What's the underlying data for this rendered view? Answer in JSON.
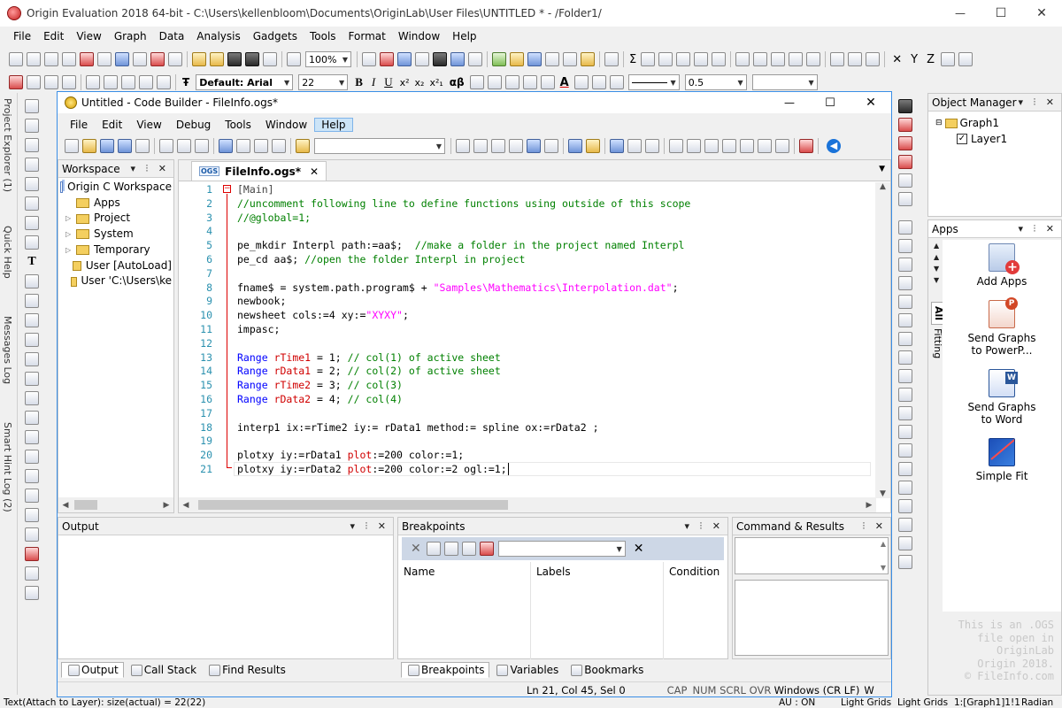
{
  "titlebar": {
    "title": "Origin Evaluation 2018 64-bit - C:\\Users\\kellenbloom\\Documents\\OriginLab\\User Files\\UNTITLED * - /Folder1/",
    "min": "—",
    "max": "☐",
    "close": "✕"
  },
  "main_menu": [
    "File",
    "Edit",
    "View",
    "Graph",
    "Data",
    "Analysis",
    "Gadgets",
    "Tools",
    "Format",
    "Window",
    "Help"
  ],
  "toolbar": {
    "zoom": "100%",
    "font_name": "Default: Arial",
    "font_size": "22",
    "bold": "B",
    "italic": "I",
    "underline": "U",
    "greek": "αβ",
    "line_width": "0.5",
    "xyz": [
      "X",
      "Y",
      "Z"
    ]
  },
  "left_tabs": [
    "Project Explorer (1)",
    "Quick Help",
    "Messages Log",
    "Smart Hint Log (2)"
  ],
  "codebuilder": {
    "title": "Untitled - Code Builder - FileInfo.ogs*",
    "menu": [
      "File",
      "Edit",
      "View",
      "Debug",
      "Tools",
      "Window",
      "Help"
    ],
    "active_menu": "Help",
    "workspace": {
      "title": "Workspace",
      "root": "Origin C Workspace",
      "items": [
        "Apps",
        "Project",
        "System",
        "Temporary",
        "User [AutoLoad]",
        "User 'C:\\Users\\ke"
      ]
    },
    "editor": {
      "tab_badge": "OGS",
      "tab": "FileInfo.ogs*",
      "lines": [
        {
          "n": "1",
          "t": [
            [
              "d",
              "[Main]"
            ]
          ]
        },
        {
          "n": "2",
          "t": [
            [
              "c",
              "//uncomment following line to define functions using outside of this scope"
            ]
          ]
        },
        {
          "n": "3",
          "t": [
            [
              "c",
              "//@global=1;"
            ]
          ]
        },
        {
          "n": "4",
          "t": []
        },
        {
          "n": "5",
          "t": [
            [
              "d",
              "pe_mkdir Interpl path:=aa$;  "
            ],
            [
              "c",
              "//make a folder in the project named Interpl"
            ]
          ]
        },
        {
          "n": "6",
          "t": [
            [
              "d",
              "pe_cd aa$; "
            ],
            [
              "c",
              "//open the folder Interpl in project"
            ]
          ]
        },
        {
          "n": "7",
          "t": []
        },
        {
          "n": "8",
          "t": [
            [
              "d",
              "fname$ = system.path.program$ + "
            ],
            [
              "s",
              "\"Samples\\Mathematics\\Interpolation.dat\""
            ],
            [
              "d",
              ";"
            ]
          ]
        },
        {
          "n": "9",
          "t": [
            [
              "d",
              "newbook;"
            ]
          ]
        },
        {
          "n": "10",
          "t": [
            [
              "d",
              "newsheet cols:=4 xy:="
            ],
            [
              "s",
              "\"XYXY\""
            ],
            [
              "d",
              ";"
            ]
          ]
        },
        {
          "n": "11",
          "t": [
            [
              "d",
              "impasc;"
            ]
          ]
        },
        {
          "n": "12",
          "t": []
        },
        {
          "n": "13",
          "t": [
            [
              "k",
              "Range"
            ],
            [
              "d",
              " "
            ],
            [
              "r",
              "rTime1"
            ],
            [
              "d",
              " = 1; "
            ],
            [
              "c",
              "// col(1) of active sheet"
            ]
          ]
        },
        {
          "n": "14",
          "t": [
            [
              "k",
              "Range"
            ],
            [
              "d",
              " "
            ],
            [
              "r",
              "rData1"
            ],
            [
              "d",
              " = 2; "
            ],
            [
              "c",
              "// col(2) of active sheet"
            ]
          ]
        },
        {
          "n": "15",
          "t": [
            [
              "k",
              "Range"
            ],
            [
              "d",
              " "
            ],
            [
              "r",
              "rTime2"
            ],
            [
              "d",
              " = 3; "
            ],
            [
              "c",
              "// col(3)"
            ]
          ]
        },
        {
          "n": "16",
          "t": [
            [
              "k",
              "Range"
            ],
            [
              "d",
              " "
            ],
            [
              "r",
              "rData2"
            ],
            [
              "d",
              " = 4; "
            ],
            [
              "c",
              "// col(4)"
            ]
          ]
        },
        {
          "n": "17",
          "t": []
        },
        {
          "n": "18",
          "t": [
            [
              "d",
              "interp1 ix:=rTime2 iy:= rData1 method:= spline ox:=rData2 ;"
            ]
          ]
        },
        {
          "n": "19",
          "t": []
        },
        {
          "n": "20",
          "t": [
            [
              "d",
              "plotxy iy:=rData1 "
            ],
            [
              "r",
              "plot"
            ],
            [
              "d",
              ":=200 color:=1;"
            ]
          ]
        },
        {
          "n": "21",
          "t": [
            [
              "d",
              "plotxy iy:=rData2 "
            ],
            [
              "r",
              "plot"
            ],
            [
              "d",
              ":=200 color:=2 ogl:=1;"
            ]
          ]
        }
      ]
    },
    "output": {
      "title": "Output"
    },
    "breakpoints": {
      "title": "Breakpoints",
      "columns": [
        "Name",
        "Labels",
        "Condition"
      ]
    },
    "command": {
      "title": "Command & Results"
    },
    "bottom_tabs_left": [
      "Output",
      "Call Stack",
      "Find Results"
    ],
    "bottom_tabs_mid": [
      "Breakpoints",
      "Variables",
      "Bookmarks"
    ],
    "status": {
      "pos": "Ln 21, Col 45, Sel 0",
      "cap": "CAP",
      "num": "NUM",
      "scrl": "SCRL",
      "ovr": "OVR",
      "eol": "Windows (CR LF)",
      "w": "W"
    }
  },
  "object_manager": {
    "title": "Object Manager",
    "graph": "Graph1",
    "layer": "Layer1"
  },
  "apps": {
    "title": "Apps",
    "tabs": [
      "All",
      "Fitting"
    ],
    "items": [
      "Add Apps",
      "Send Graphs to PowerP...",
      "Send Graphs to Word",
      "Simple Fit"
    ]
  },
  "watermark": [
    "This is an .OGS",
    "file open in",
    "OriginLab",
    "Origin 2018.",
    "© FileInfo.com"
  ],
  "statusbar": {
    "left": "Text(Attach to Layer): size(actual) = 22(22)",
    "au": "AU : ON",
    "light1": "Light Grids",
    "light2": "Light Grids",
    "graph": "1:[Graph1]1!1",
    "unit": "Radian"
  },
  "colors": {
    "comment": "#008000",
    "keyword": "#0000ff",
    "string": "#ff00ff",
    "red": "#d00000",
    "accent": "#0078d7"
  }
}
